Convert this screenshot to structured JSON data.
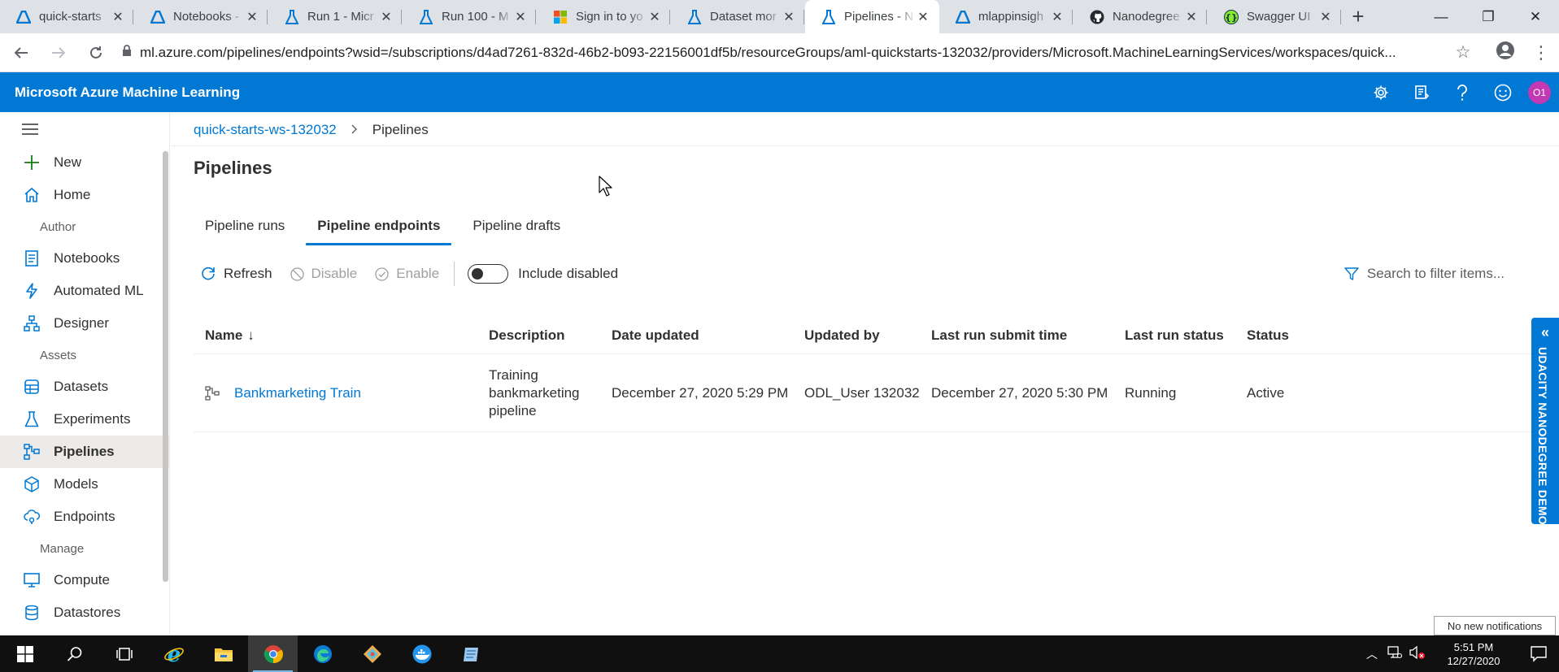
{
  "browser": {
    "tabs": [
      {
        "label": "quick-starts",
        "icon": "azure-ml-icon"
      },
      {
        "label": "Notebooks - ",
        "icon": "azure-ml-icon"
      },
      {
        "label": "Run 1 - Micr",
        "icon": "flask-icon"
      },
      {
        "label": "Run 100 - M",
        "icon": "flask-icon"
      },
      {
        "label": "Sign in to yo",
        "icon": "microsoft-icon"
      },
      {
        "label": "Dataset mor",
        "icon": "flask-icon"
      },
      {
        "label": "Pipelines - N",
        "icon": "flask-icon",
        "active": true
      },
      {
        "label": "mlappinsigh",
        "icon": "azure-ml-icon"
      },
      {
        "label": "Nanodegree",
        "icon": "github-icon"
      },
      {
        "label": "Swagger UI",
        "icon": "swagger-icon"
      }
    ],
    "url": "ml.azure.com/pipelines/endpoints?wsid=/subscriptions/d4ad7261-832d-46b2-b093-22156001df5b/resourceGroups/aml-quickstarts-132032/providers/Microsoft.MachineLearningServices/workspaces/quick..."
  },
  "header": {
    "brand": "Microsoft Azure Machine Learning",
    "avatar_initials": "O1",
    "accent": "#0078d4"
  },
  "sidebar": {
    "items": [
      {
        "label": "New",
        "icon": "plus-icon"
      },
      {
        "label": "Home",
        "icon": "home-icon"
      },
      {
        "section": "Author"
      },
      {
        "label": "Notebooks",
        "icon": "notebook-icon"
      },
      {
        "label": "Automated ML",
        "icon": "automl-icon"
      },
      {
        "label": "Designer",
        "icon": "designer-icon"
      },
      {
        "section": "Assets"
      },
      {
        "label": "Datasets",
        "icon": "datasets-icon"
      },
      {
        "label": "Experiments",
        "icon": "flask-icon"
      },
      {
        "label": "Pipelines",
        "icon": "pipeline-icon",
        "active": true
      },
      {
        "label": "Models",
        "icon": "models-icon"
      },
      {
        "label": "Endpoints",
        "icon": "endpoints-icon"
      },
      {
        "section": "Manage"
      },
      {
        "label": "Compute",
        "icon": "compute-icon"
      },
      {
        "label": "Datastores",
        "icon": "datastore-icon"
      }
    ]
  },
  "breadcrumb": {
    "workspace": "quick-starts-ws-132032",
    "current": "Pipelines"
  },
  "page": {
    "title": "Pipelines",
    "tabs": [
      "Pipeline runs",
      "Pipeline endpoints",
      "Pipeline drafts"
    ],
    "active_tab": 1
  },
  "toolbar": {
    "refresh": "Refresh",
    "disable": "Disable",
    "enable": "Enable",
    "include_disabled": "Include disabled",
    "search_placeholder": "Search to filter items..."
  },
  "table": {
    "columns": [
      "Name",
      "Description",
      "Date updated",
      "Updated by",
      "Last run submit time",
      "Last run status",
      "Status"
    ],
    "sort_indicator": "↓",
    "rows": [
      {
        "name": "Bankmarketing Train",
        "description": "Training bankmarketing pipeline",
        "date_updated": "December 27, 2020 5:29 PM",
        "updated_by": "ODL_User 132032",
        "last_run_submit_time": "December 27, 2020 5:30 PM",
        "last_run_status": "Running",
        "status": "Active"
      }
    ]
  },
  "side_panel": {
    "label": "UDACITY NANODEGREE DEMO"
  },
  "notification": "No new notifications",
  "taskbar": {
    "time": "5:51 PM",
    "date": "12/27/2020"
  }
}
